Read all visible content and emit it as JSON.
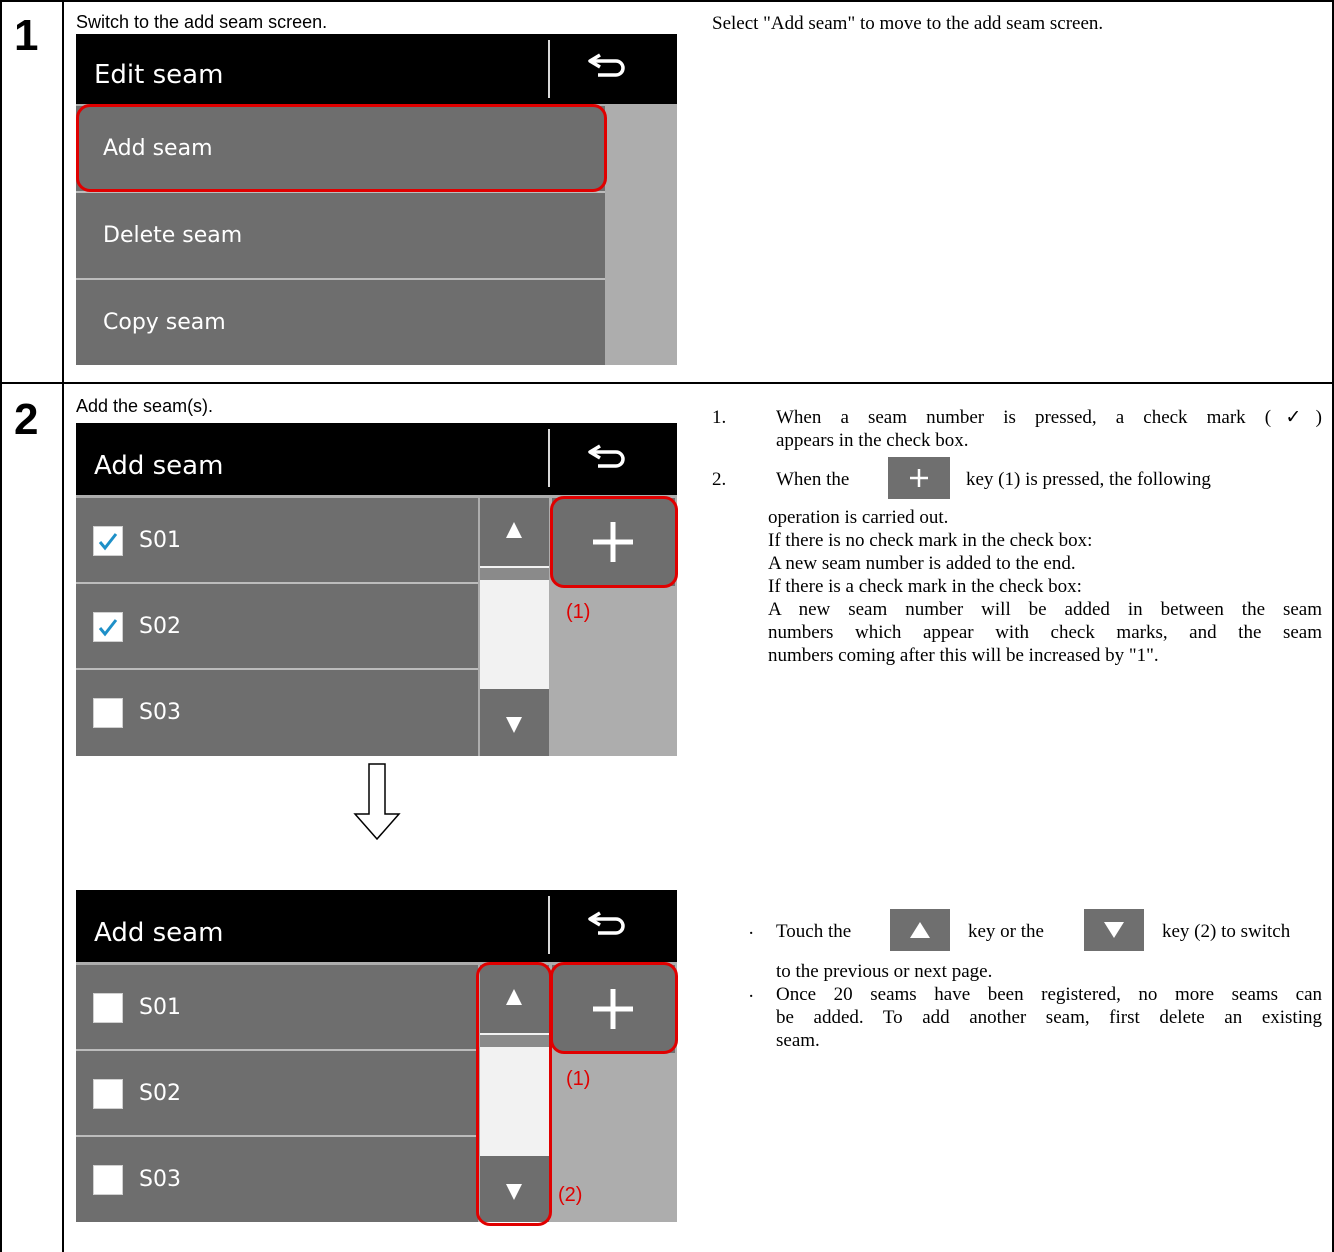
{
  "table": {
    "rows": [
      {
        "step": "1",
        "caption": "Switch to the add seam screen.",
        "description": "Select \"Add seam\" to move to the add seam screen.",
        "screen": {
          "title": "Edit seam",
          "items": [
            "Add seam",
            "Delete seam",
            "Copy seam"
          ]
        }
      },
      {
        "step": "2",
        "caption": "Add the seam(s).",
        "screen_before": {
          "title": "Add seam",
          "items": [
            {
              "label": "S01",
              "checked": true
            },
            {
              "label": "S02",
              "checked": true
            },
            {
              "label": "S03",
              "checked": false
            }
          ],
          "callout_1": "(1)"
        },
        "screen_after": {
          "title": "Add seam",
          "items": [
            {
              "label": "S01",
              "checked": false
            },
            {
              "label": "S02",
              "checked": false
            },
            {
              "label": "S03",
              "checked": false
            }
          ],
          "callout_1": "(1)",
          "callout_2": "(2)"
        },
        "notes_numbered": [
          {
            "num": "1.",
            "lines": [
              "When a seam number is pressed, a check mark (✓)",
              "appears in the check box."
            ]
          },
          {
            "num": "2.",
            "line1_a": "When the",
            "line1_b": "key (1) is pressed, the following",
            "lines": [
              "operation is carried out.",
              "If there is no check mark in the check box:",
              "A new seam number is added to the end.",
              "If there is a check mark in the check box:",
              "A new seam number will be added in between the seam",
              "numbers which appear with check marks, and the seam",
              "numbers coming after this will be increased by \"1\"."
            ]
          }
        ],
        "notes_bullets": [
          {
            "bullet": "·",
            "line1_a": "Touch the",
            "line1_b": "key or the",
            "line1_c": "key (2) to switch",
            "lines": [
              "to the previous or next page."
            ]
          },
          {
            "bullet": "·",
            "lines": [
              "Once 20 seams have been registered, no more seams can",
              "be added. To add another seam, first delete an existing",
              "seam."
            ]
          }
        ]
      }
    ]
  },
  "colors": {
    "screen_bg": "#adadad",
    "row_bg": "#6e6e6e",
    "header_bg": "#000000",
    "highlight": "#e00000",
    "check": "#1e90c8"
  },
  "icons": [
    "back-arrow-icon",
    "plus-icon",
    "triangle-up-icon",
    "triangle-down-icon",
    "check-icon",
    "down-arrow-icon"
  ]
}
